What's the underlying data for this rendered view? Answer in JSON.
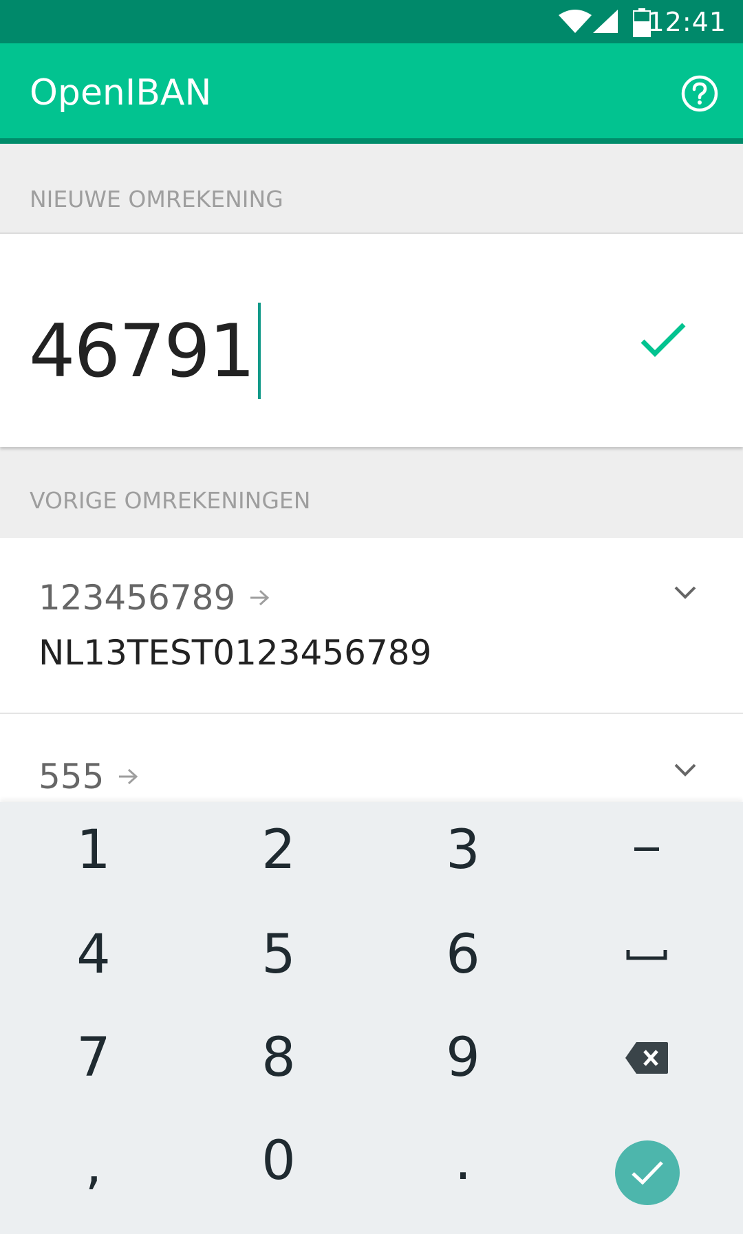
{
  "status_bar": {
    "time": "12:41",
    "icons": [
      "wifi-icon",
      "cell-signal-icon",
      "battery-icon"
    ]
  },
  "app_bar": {
    "title": "OpenIBAN",
    "help_icon": "help-circle-icon"
  },
  "new_section": {
    "header": "NIEUWE OMREKENING",
    "input_value": "46791",
    "confirm_icon": "check-icon"
  },
  "history_section": {
    "header": "VORIGE OMREKENINGEN",
    "items": [
      {
        "from": "123456789",
        "to": "NL13TEST0123456789"
      },
      {
        "from": "555",
        "to": ""
      }
    ]
  },
  "keyboard": {
    "keys": [
      [
        "1",
        "2",
        "3",
        "–"
      ],
      [
        "4",
        "5",
        "6",
        "␣"
      ],
      [
        "7",
        "8",
        "9",
        "⌫"
      ],
      [
        ",",
        "0",
        ".",
        "✓"
      ]
    ]
  },
  "colors": {
    "status_bar": "#00896a",
    "app_bar": "#02c390",
    "accent": "#02c390",
    "enter_key": "#4db6ac",
    "keyboard_bg": "#eceff1"
  }
}
